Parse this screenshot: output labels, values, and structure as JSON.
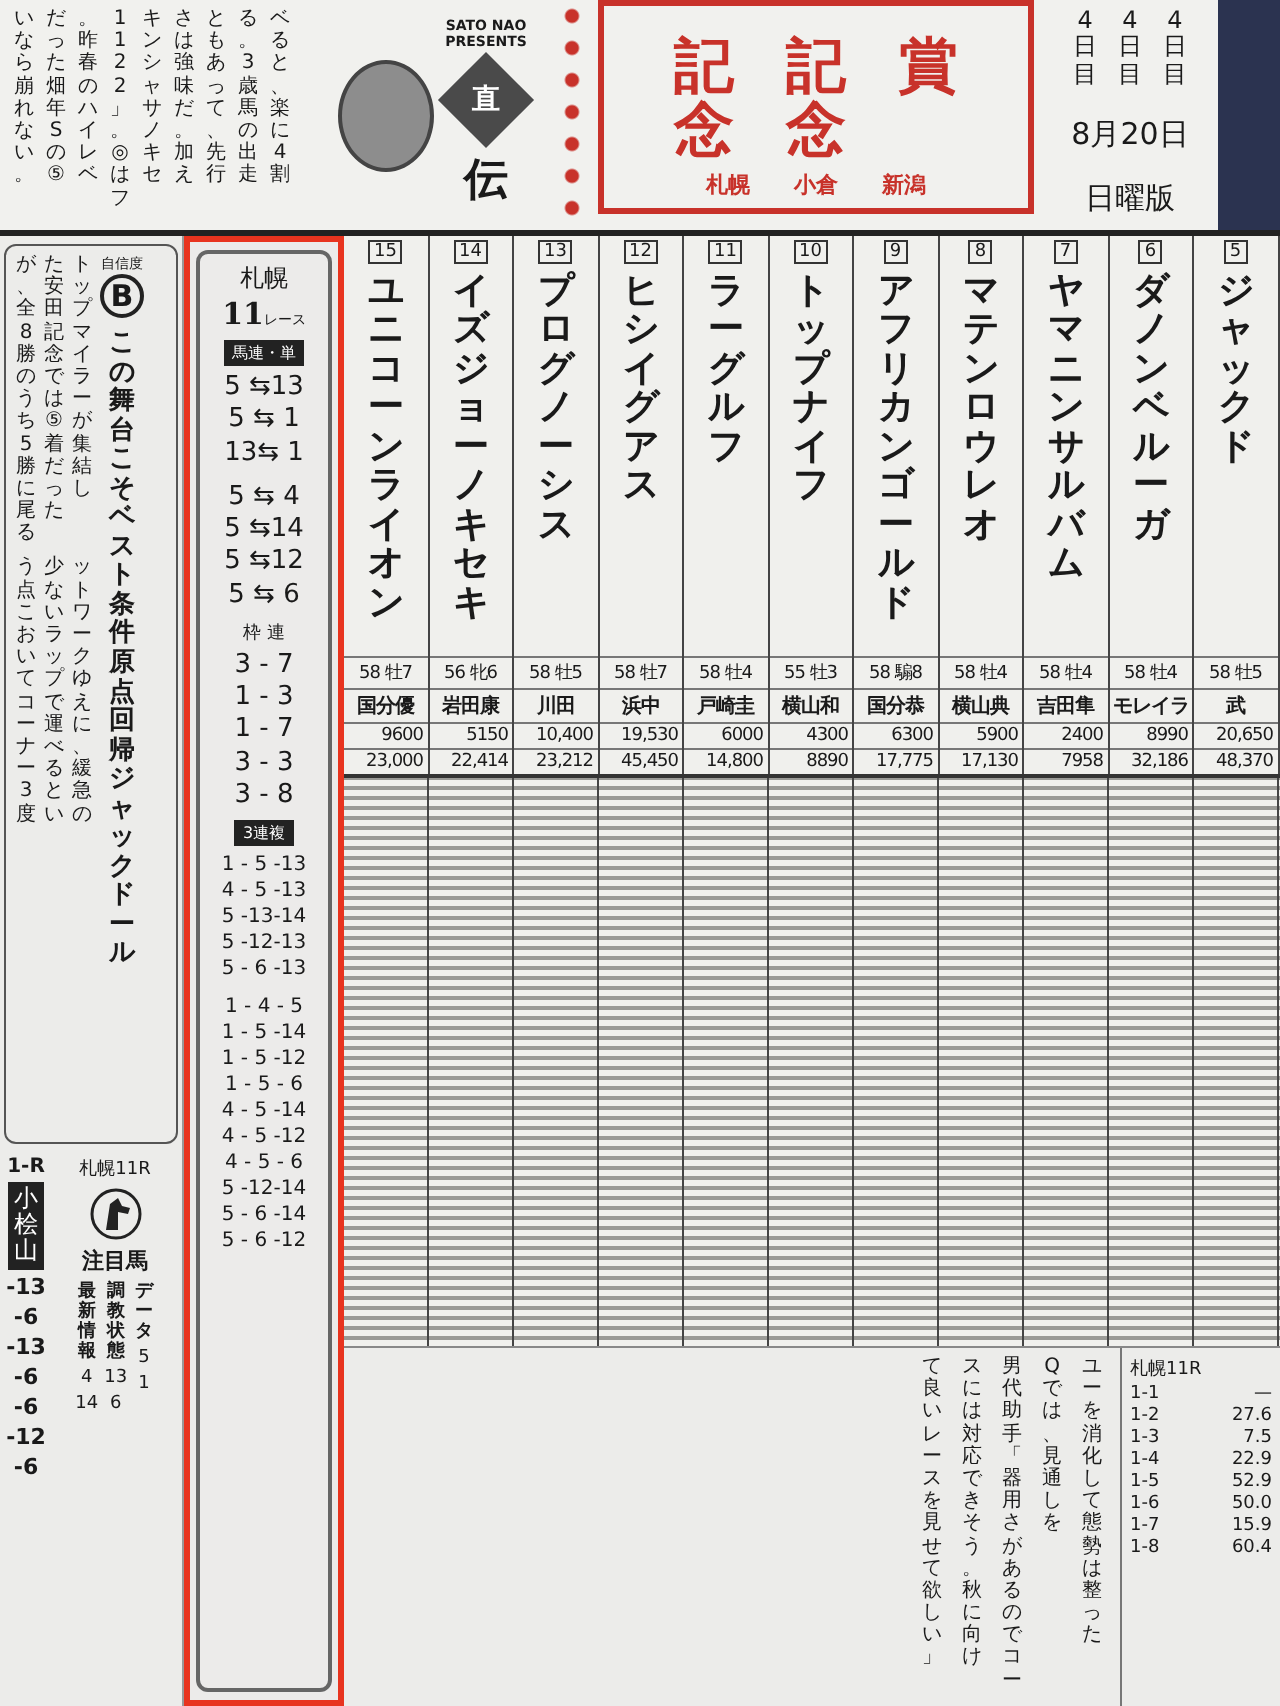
{
  "header": {
    "article_columns": [
      "いなら崩れない。",
      "だった畑年Sの⑤",
      "。昨春のハイレベ",
      "1122」。◎はフ",
      "キンシャサノキセ",
      "さは強味だ。加え",
      "ともあって、先行",
      "る。3歳馬の出走",
      "ベると、楽に4割"
    ],
    "presenter": "SATO NAO PRESENTS",
    "diamond": "直",
    "diamond_sub": "伝",
    "title_columns": [
      "記念",
      "記念",
      "賞"
    ],
    "venues": [
      "札幌",
      "小倉",
      "新潟"
    ],
    "days": [
      "4日目",
      "4日目",
      "4日目"
    ],
    "date": "8月20日",
    "edition": "日曜版"
  },
  "left_column": {
    "confidence_label": "自信度",
    "confidence": "B",
    "headline": "この舞台こそベスト条件原点回帰ジャックドール",
    "body_top": [
      "が、全8勝のうち5勝に尾る",
      "た安田記念では⑤着だった",
      "トップマイラーが集結し"
    ],
    "body_bottom": [
      "う点こおいてコーナー3度",
      "少ないラップで運べるとい",
      "ットワークゆえに、緩急の"
    ],
    "race_label": "1-R",
    "race_name": "小桧山",
    "race_venue": "札幌11R",
    "attention_title": "注目馬",
    "attention_columns": [
      {
        "label": "最新情報",
        "values": [
          "4",
          "14"
        ]
      },
      {
        "label": "調教状態",
        "values": [
          "13",
          "6"
        ]
      },
      {
        "label": "データ",
        "values": [
          "5",
          "1"
        ]
      }
    ],
    "pick_fragments": [
      "-13",
      "-6",
      "-13",
      "-6",
      "-6",
      "-12",
      "-6"
    ]
  },
  "picks": {
    "venue": "札幌",
    "race": "11",
    "race_unit": "レース",
    "items": [
      {
        "kind": "badge",
        "text": "馬連・単"
      },
      {
        "kind": "pair",
        "text": "5 ⇆13"
      },
      {
        "kind": "pair",
        "text": "5 ⇆ 1"
      },
      {
        "kind": "pair",
        "text": "13⇆ 1"
      },
      {
        "kind": "gap"
      },
      {
        "kind": "pair",
        "text": "5 ⇆ 4"
      },
      {
        "kind": "pair",
        "text": "5 ⇆14"
      },
      {
        "kind": "pair",
        "text": "5 ⇆12"
      },
      {
        "kind": "pair",
        "text": "5 ⇆ 6"
      },
      {
        "kind": "label",
        "text": "枠 連"
      },
      {
        "kind": "pair",
        "text": "3 - 7"
      },
      {
        "kind": "pair",
        "text": "1 - 3"
      },
      {
        "kind": "pair",
        "text": "1 - 7"
      },
      {
        "kind": "pair",
        "text": "3 - 3"
      },
      {
        "kind": "pair",
        "text": "3 - 8"
      },
      {
        "kind": "badge",
        "text": "3連複"
      },
      {
        "kind": "trio",
        "text": "1 - 5 -13"
      },
      {
        "kind": "trio",
        "text": "4 - 5 -13"
      },
      {
        "kind": "trio",
        "text": "5 -13-14"
      },
      {
        "kind": "trio",
        "text": "5 -12-13"
      },
      {
        "kind": "trio",
        "text": "5 - 6 -13"
      },
      {
        "kind": "gap"
      },
      {
        "kind": "trio",
        "text": "1 - 4 - 5"
      },
      {
        "kind": "trio",
        "text": "1 - 5 -14"
      },
      {
        "kind": "trio",
        "text": "1 - 5 -12"
      },
      {
        "kind": "trio",
        "text": "1 - 5 - 6"
      },
      {
        "kind": "trio",
        "text": "4 - 5 -14"
      },
      {
        "kind": "trio",
        "text": "4 - 5 -12"
      },
      {
        "kind": "trio",
        "text": "4 - 5 - 6"
      },
      {
        "kind": "trio",
        "text": "5 -12-14"
      },
      {
        "kind": "trio",
        "text": "5 - 6 -14"
      },
      {
        "kind": "trio",
        "text": "5 - 6 -12"
      }
    ]
  },
  "horses": [
    {
      "number": "15",
      "name": "ユニコーンライオン",
      "weight_age": "58 牡7",
      "jockey": "国分優",
      "prize_1": "9600",
      "prize_2": "23,000"
    },
    {
      "number": "14",
      "name": "イズジョーノキセキ",
      "weight_age": "56 牝6",
      "jockey": "岩田康",
      "prize_1": "5150",
      "prize_2": "22,414"
    },
    {
      "number": "13",
      "name": "プログノーシス",
      "weight_age": "58 牡5",
      "jockey": "川田",
      "prize_1": "10,400",
      "prize_2": "23,212"
    },
    {
      "number": "12",
      "name": "ヒシイグアス",
      "weight_age": "58 牡7",
      "jockey": "浜中",
      "prize_1": "19,530",
      "prize_2": "45,450"
    },
    {
      "number": "11",
      "name": "ラーグルフ",
      "weight_age": "58 牡4",
      "jockey": "戸崎圭",
      "prize_1": "6000",
      "prize_2": "14,800"
    },
    {
      "number": "10",
      "name": "トップナイフ",
      "weight_age": "55 牡3",
      "jockey": "横山和",
      "prize_1": "4300",
      "prize_2": "8890"
    },
    {
      "number": "9",
      "name": "アフリカンゴールド",
      "weight_age": "58 騸8",
      "jockey": "国分恭",
      "prize_1": "6300",
      "prize_2": "17,775"
    },
    {
      "number": "8",
      "name": "マテンロウレオ",
      "weight_age": "58 牡4",
      "jockey": "横山典",
      "prize_1": "5900",
      "prize_2": "17,130"
    },
    {
      "number": "7",
      "name": "ヤマニンサルバム",
      "weight_age": "58 牡4",
      "jockey": "吉田隼",
      "prize_1": "2400",
      "prize_2": "7958"
    },
    {
      "number": "6",
      "name": "ダノンベルーガ",
      "weight_age": "58 牡4",
      "jockey": "モレイラ",
      "prize_1": "8990",
      "prize_2": "32,186"
    },
    {
      "number": "5",
      "name": "ジャックド",
      "weight_age": "58 牡5",
      "jockey": "武",
      "prize_1": "20,650",
      "prize_2": "48,370"
    }
  ],
  "bottom": {
    "comment_columns": [
      "て良いレースを見せて欲しい」",
      "スには対応できそう。秋に向け",
      "男代助手「器用さがあるのでコー",
      "Qでは、見通しを",
      "ユーを消化して態勢は整った"
    ],
    "odds_title": "札幌11R",
    "odds": [
      {
        "pair": "1-1",
        "value": "—"
      },
      {
        "pair": "1-2",
        "value": "27.6"
      },
      {
        "pair": "1-3",
        "value": "7.5"
      },
      {
        "pair": "1-4",
        "value": "22.9"
      },
      {
        "pair": "1-5",
        "value": "52.9"
      },
      {
        "pair": "1-6",
        "value": "50.0"
      },
      {
        "pair": "1-7",
        "value": "15.9"
      },
      {
        "pair": "1-8",
        "value": "60.4"
      }
    ]
  }
}
